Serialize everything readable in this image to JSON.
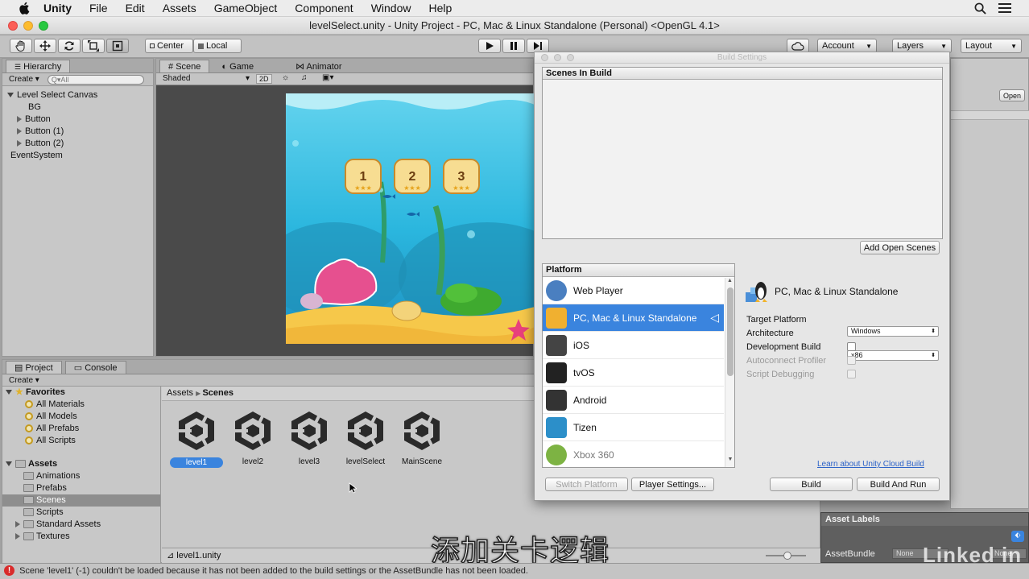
{
  "menubar": {
    "app": "Unity",
    "items": [
      "File",
      "Edit",
      "Assets",
      "GameObject",
      "Component",
      "Window",
      "Help"
    ]
  },
  "window": {
    "title": "levelSelect.unity - Unity Project - PC, Mac & Linux Standalone (Personal) <OpenGL 4.1>"
  },
  "toolbar": {
    "pivot_center": "Center",
    "pivot_local": "Local",
    "account": "Account",
    "layers": "Layers",
    "layout": "Layout"
  },
  "hierarchy": {
    "tab": "Hierarchy",
    "create": "Create",
    "search_placeholder": "Q▾All",
    "items": [
      {
        "label": "Level Select Canvas",
        "indent": 0,
        "expand": "down"
      },
      {
        "label": "BG",
        "indent": 1,
        "expand": "none"
      },
      {
        "label": "Button",
        "indent": 1,
        "expand": "right"
      },
      {
        "label": "Button (1)",
        "indent": 1,
        "expand": "right"
      },
      {
        "label": "Button (2)",
        "indent": 1,
        "expand": "right"
      },
      {
        "label": "EventSystem",
        "indent": 0,
        "expand": "none"
      }
    ]
  },
  "scene": {
    "tabs": [
      "Scene",
      "Game",
      "Animator"
    ],
    "shading": "Shaded",
    "mode_2d": "2D",
    "level_buttons": [
      "1",
      "2",
      "3"
    ]
  },
  "inspector": {
    "open_button": "Open"
  },
  "project": {
    "tabs": [
      "Project",
      "Console"
    ],
    "create": "Create",
    "favorites_label": "Favorites",
    "favorites": [
      "All Materials",
      "All Models",
      "All Prefabs",
      "All Scripts"
    ],
    "assets_label": "Assets",
    "folders": [
      {
        "label": "Animations",
        "selected": false,
        "expand": "none"
      },
      {
        "label": "Prefabs",
        "selected": false,
        "expand": "none"
      },
      {
        "label": "Scenes",
        "selected": true,
        "expand": "none"
      },
      {
        "label": "Scripts",
        "selected": false,
        "expand": "none"
      },
      {
        "label": "Standard Assets",
        "selected": false,
        "expand": "right"
      },
      {
        "label": "Textures",
        "selected": false,
        "expand": "right"
      }
    ],
    "breadcrumb": [
      "Assets",
      "Scenes"
    ],
    "scene_assets": [
      "level1",
      "level2",
      "level3",
      "levelSelect",
      "MainScene"
    ],
    "selected_asset": "level1",
    "footer_file": "level1.unity"
  },
  "build_settings": {
    "title": "Build Settings",
    "scenes_in_build": "Scenes In Build",
    "add_open_scenes": "Add Open Scenes",
    "platform_header": "Platform",
    "platforms": [
      {
        "label": "Web Player",
        "selected": false,
        "icon": "globe-icon",
        "color": "#4a7fc0"
      },
      {
        "label": "PC, Mac & Linux Standalone",
        "selected": true,
        "icon": "penguin-icon",
        "color": "#f0b030"
      },
      {
        "label": "iOS",
        "selected": false,
        "icon": "ios-device-icon",
        "color": "#444444"
      },
      {
        "label": "tvOS",
        "selected": false,
        "icon": "apple-tv-icon",
        "color": "#222222"
      },
      {
        "label": "Android",
        "selected": false,
        "icon": "android-phone-icon",
        "color": "#333333"
      },
      {
        "label": "Tizen",
        "selected": false,
        "icon": "tizen-icon",
        "color": "#2c8fc9"
      },
      {
        "label": "Xbox 360",
        "selected": false,
        "icon": "xbox-icon",
        "color": "#7db343"
      }
    ],
    "selected_platform_title": "PC, Mac & Linux Standalone",
    "target_platform_label": "Target Platform",
    "target_platform_value": "Windows",
    "architecture_label": "Architecture",
    "architecture_value": "x86",
    "development_build_label": "Development Build",
    "autoconnect_profiler_label": "Autoconnect Profiler",
    "script_debugging_label": "Script Debugging",
    "cloud_build_link": "Learn about Unity Cloud Build",
    "switch_platform": "Switch Platform",
    "player_settings": "Player Settings...",
    "build": "Build",
    "build_and_run": "Build And Run"
  },
  "asset_labels": {
    "header": "Asset Labels",
    "assetbundle_label": "AssetBundle",
    "assetbundle_value": "None",
    "variant_value": "None"
  },
  "overlay": {
    "subtitle": "添加关卡逻辑",
    "watermark": "Linked in"
  },
  "status": {
    "message": "Scene 'level1' (-1) couldn't be loaded because it has not been added to the build settings or the AssetBundle has not been loaded."
  },
  "colors": {
    "selection_blue": "#3a84de",
    "error_red": "#d92b2b",
    "link_blue": "#2d63c8"
  }
}
